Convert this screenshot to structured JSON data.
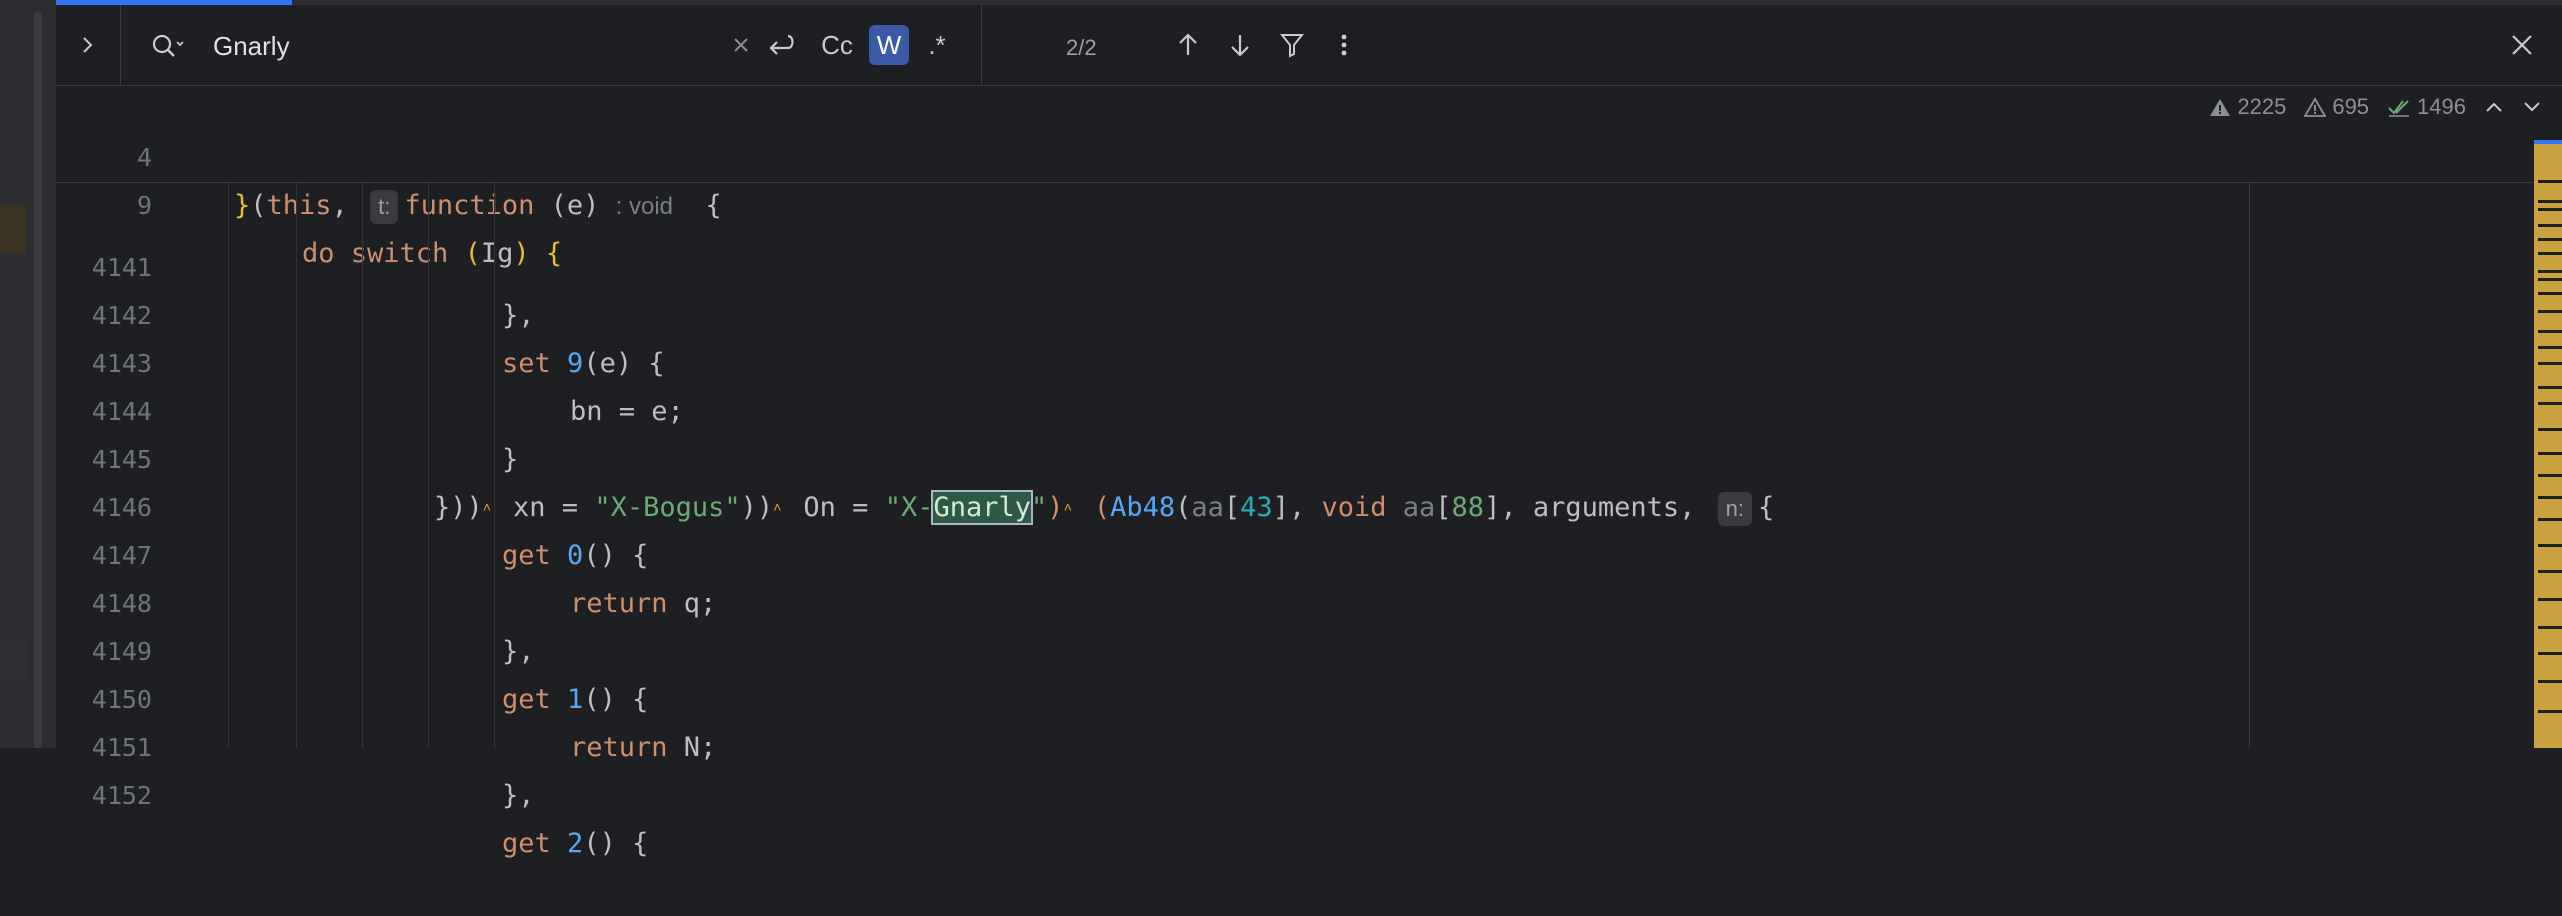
{
  "search": {
    "query": "Gnarly",
    "match_count": "2/2",
    "options": {
      "preserve_case": "Cc",
      "words": "W",
      "regex": ".*"
    }
  },
  "inspections": {
    "errors": "2225",
    "warnings": "695",
    "weak_warnings": "1496"
  },
  "sticky_lines": [
    {
      "num": "4"
    },
    {
      "num": "9"
    }
  ],
  "hints": {
    "t_label": "t:",
    "void_label": ": void",
    "n_label": "n:"
  },
  "lines": [
    {
      "num": "4141",
      "text": "},"
    },
    {
      "num": "4142"
    },
    {
      "num": "4143"
    },
    {
      "num": "4144",
      "text": "}"
    },
    {
      "num": "4145"
    },
    {
      "num": "4146"
    },
    {
      "num": "4147"
    },
    {
      "num": "4148",
      "text": "},"
    },
    {
      "num": "4149"
    },
    {
      "num": "4150"
    },
    {
      "num": "4151",
      "text": "},"
    },
    {
      "num": "4152"
    }
  ],
  "colors": {
    "accent": "#3574f0",
    "keyword": "#cf8e6d",
    "function": "#56a8f5",
    "string": "#6aab73",
    "number": "#2aacb8",
    "minimap": "#c9a13f"
  }
}
